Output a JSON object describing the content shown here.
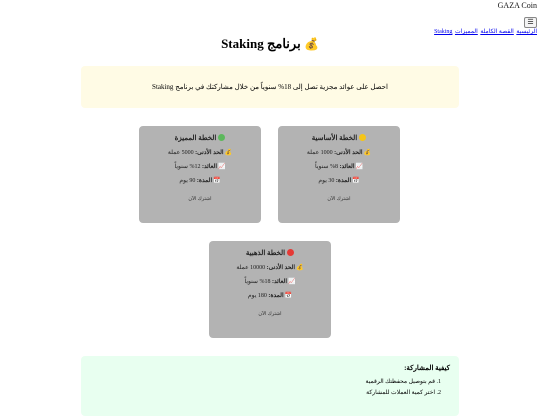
{
  "header": {
    "brand": "GAZA Coin",
    "menu_icon": "☰",
    "nav": [
      "الرئيسية",
      "القصة الكاملة",
      "المميزات",
      "Staking"
    ]
  },
  "page": {
    "title": "برنامج Staking",
    "title_emoji": "💰",
    "intro": "احصل على عوائد مجزية تصل إلى 18% سنوياً من خلال مشاركتك في برنامج Staking"
  },
  "labels": {
    "min": "الحد الأدنى:",
    "yield": "العائد:",
    "period": "المدة:",
    "join": "اشترك الآن"
  },
  "plans": [
    {
      "name": "الخطة الأساسية",
      "color": "#f5c518",
      "min": "1000 عملة",
      "yield": "8% سنوياً",
      "period": "30 يوم"
    },
    {
      "name": "الخطة المميزة",
      "color": "#5cb85c",
      "min": "5000 عملة",
      "yield": "12% سنوياً",
      "period": "90 يوم"
    },
    {
      "name": "الخطة الذهبية",
      "color": "#e53935",
      "min": "10000 عملة",
      "yield": "18% سنوياً",
      "period": "180 يوم"
    }
  ],
  "howto": {
    "title": "كيفية المشاركة:",
    "steps": [
      "قم بتوصيل محفظتك الرقمية",
      "اختر كمية العملات للمشاركة"
    ]
  }
}
